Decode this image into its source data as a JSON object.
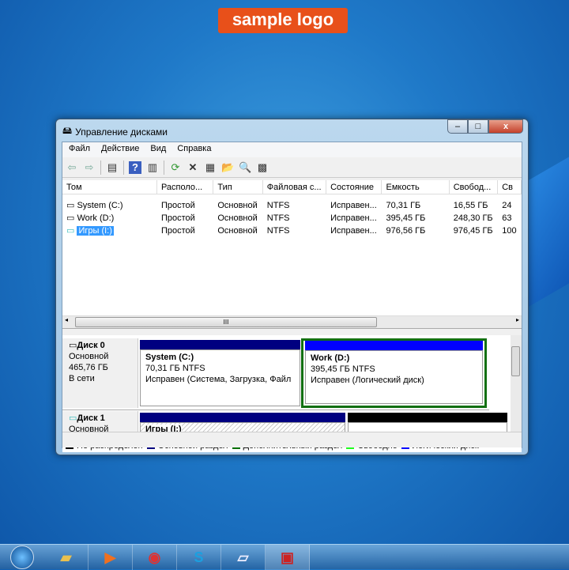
{
  "logo": "sample logo",
  "window": {
    "title": "Управление дисками",
    "min": "–",
    "max": "□",
    "close": "x"
  },
  "menu": [
    "Файл",
    "Действие",
    "Вид",
    "Справка"
  ],
  "columns": [
    "Том",
    "Располо...",
    "Тип",
    "Файловая с...",
    "Состояние",
    "Емкость",
    "Свобод...",
    "Св"
  ],
  "volumes": [
    {
      "name": "System (C:)",
      "layout": "Простой",
      "type": "Основной",
      "fs": "NTFS",
      "status": "Исправен...",
      "capacity": "70,31 ГБ",
      "free": "16,55 ГБ",
      "pct": "24"
    },
    {
      "name": "Work (D:)",
      "layout": "Простой",
      "type": "Основной",
      "fs": "NTFS",
      "status": "Исправен...",
      "capacity": "395,45 ГБ",
      "free": "248,30 ГБ",
      "pct": "63"
    },
    {
      "name": "Игры (I:)",
      "layout": "Простой",
      "type": "Основной",
      "fs": "NTFS",
      "status": "Исправен...",
      "capacity": "976,56 ГБ",
      "free": "976,45 ГБ",
      "pct": "100"
    }
  ],
  "disks": [
    {
      "name": "Диск 0",
      "type": "Основной",
      "size": "465,76 ГБ",
      "state": "В сети",
      "parts": [
        {
          "title": "System  (C:)",
          "size": "70,31 ГБ NTFS",
          "status": "Исправен (Система, Загрузка, Файл"
        },
        {
          "title": "Work  (D:)",
          "size": "395,45 ГБ NTFS",
          "status": "Исправен (Логический диск)"
        }
      ]
    },
    {
      "name": "Диск 1",
      "type": "Основной",
      "parts": [
        {
          "title": "Игры  (I:)"
        }
      ]
    }
  ],
  "legend": [
    {
      "label": "Не распределен",
      "color": "#000000"
    },
    {
      "label": "Основной раздел",
      "color": "#000080"
    },
    {
      "label": "Дополнительный раздел",
      "color": "#007000"
    },
    {
      "label": "Свободно",
      "color": "#20ff20"
    },
    {
      "label": "Логический диск",
      "color": "#0000ff"
    }
  ],
  "taskbar": [
    "explorer",
    "media-player",
    "chrome",
    "skype",
    "notepad",
    "toolbox"
  ]
}
